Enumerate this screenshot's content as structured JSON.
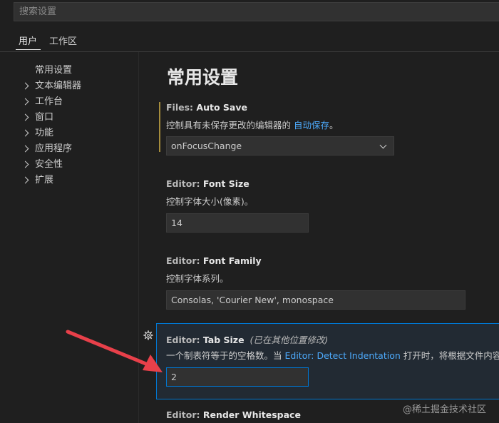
{
  "search": {
    "placeholder": "搜索设置"
  },
  "tabs": {
    "user": "用户",
    "workspace": "工作区"
  },
  "toc": [
    {
      "label": "常用设置",
      "expandable": false
    },
    {
      "label": "文本编辑器",
      "expandable": true
    },
    {
      "label": "工作台",
      "expandable": true
    },
    {
      "label": "窗口",
      "expandable": true
    },
    {
      "label": "功能",
      "expandable": true
    },
    {
      "label": "应用程序",
      "expandable": true
    },
    {
      "label": "安全性",
      "expandable": true
    },
    {
      "label": "扩展",
      "expandable": true
    }
  ],
  "main": {
    "section_title": "常用设置",
    "auto_save": {
      "category": "Files: ",
      "key": "Auto Save",
      "description": "控制具有未保存更改的编辑器的 ",
      "link": "自动保存",
      "description_end": "。",
      "value": "onFocusChange"
    },
    "font_size": {
      "category": "Editor: ",
      "key": "Font Size",
      "description": "控制字体大小(像素)。",
      "value": "14"
    },
    "font_family": {
      "category": "Editor: ",
      "key": "Font Family",
      "description": "控制字体系列。",
      "value": "Consolas, 'Courier New', monospace"
    },
    "tab_size": {
      "category": "Editor: ",
      "key": "Tab Size",
      "note": "(已在其他位置修改)",
      "description": "一个制表符等于的空格数。当 ",
      "link": "Editor: Detect Indentation",
      "description_end": " 打开时，将根据文件内容",
      "value": "2"
    },
    "render_whitespace": {
      "category": "Editor: ",
      "key": "Render Whitespace"
    }
  },
  "watermark": "@稀土掘金技术社区",
  "colors": {
    "background": "#1f1f1f",
    "focus_border": "#0078d4",
    "link": "#4daafc",
    "modified_indicator": "#a58c3c",
    "annotation_arrow": "#e8404a"
  },
  "icons": {
    "chevron": "chevron-right-icon",
    "gear": "gear-icon",
    "dropdown": "chevron-down-icon"
  }
}
